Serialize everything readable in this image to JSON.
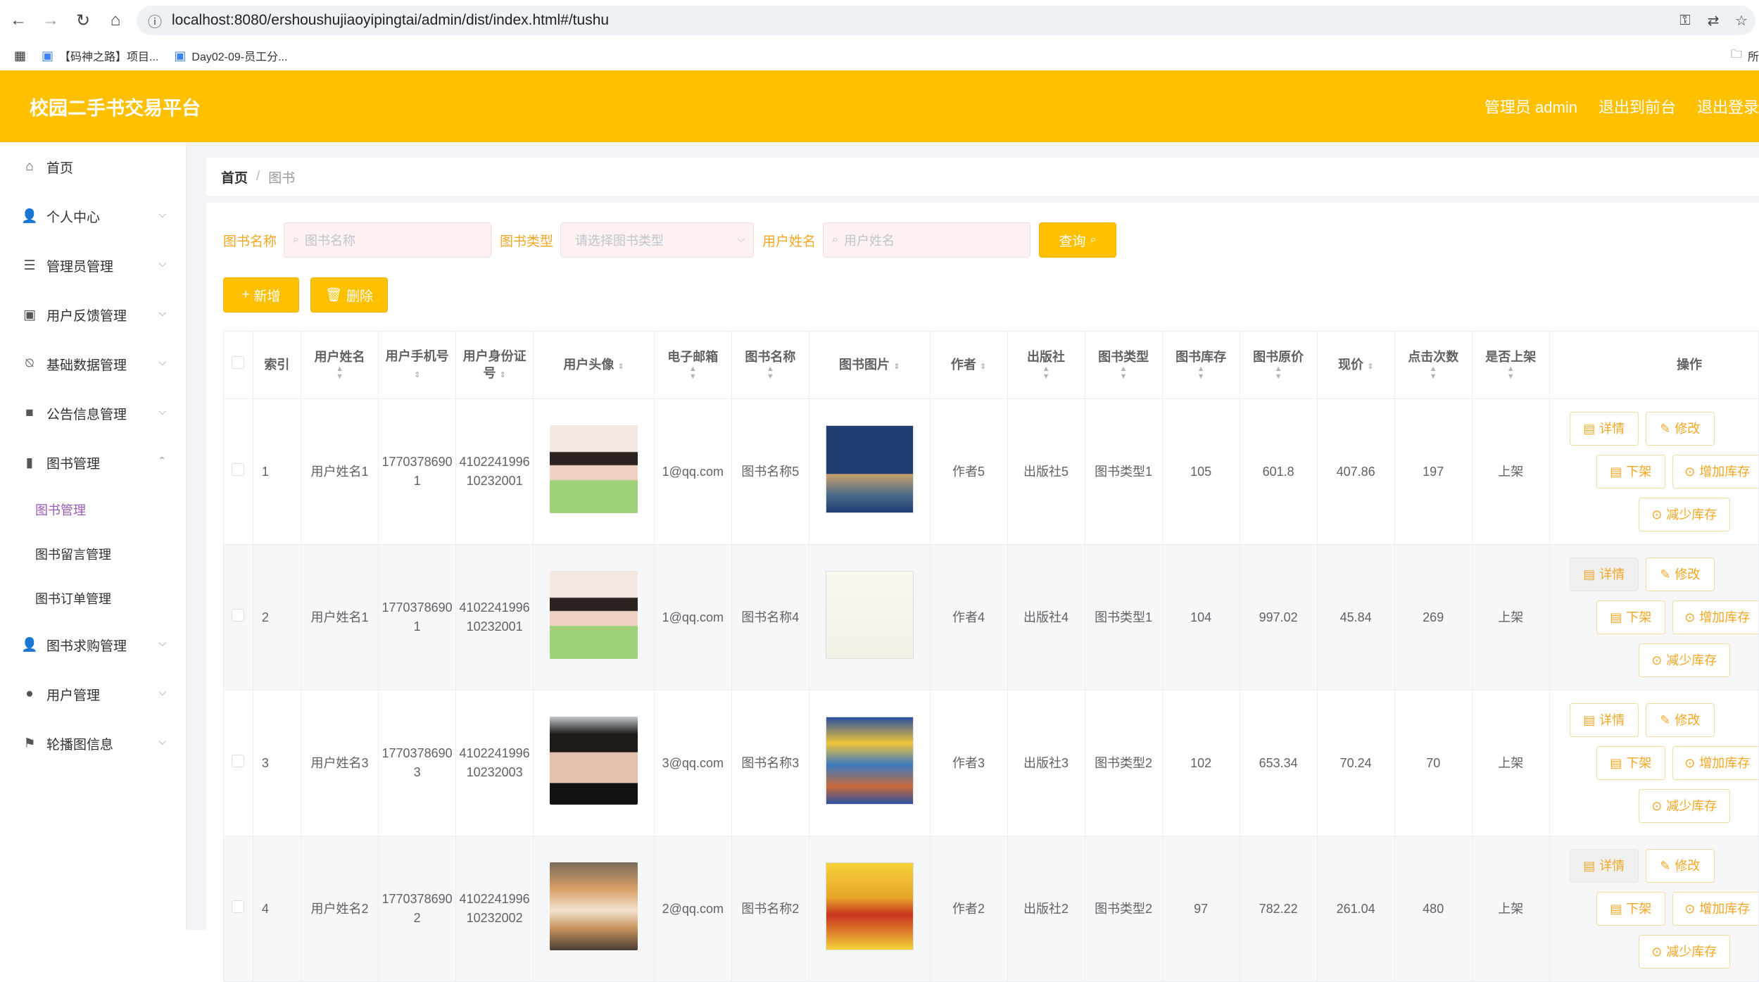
{
  "browser": {
    "url": "localhost:8080/ershoushujiaoyipingtai/admin/dist/index.html#/tushu",
    "bookmarks": [
      "【码神之路】项目...",
      "Day02-09-员工分..."
    ],
    "bookmarks_right": "所"
  },
  "header": {
    "brand": "校园二手书交易平台",
    "admin_label": "管理员 admin",
    "to_front": "退出到前台",
    "logout": "退出登录"
  },
  "sidebar": {
    "items": [
      {
        "label": "首页"
      },
      {
        "label": "个人中心"
      },
      {
        "label": "管理员管理"
      },
      {
        "label": "用户反馈管理"
      },
      {
        "label": "基础数据管理"
      },
      {
        "label": "公告信息管理"
      },
      {
        "label": "图书管理"
      },
      {
        "label": "图书求购管理"
      },
      {
        "label": "用户管理"
      },
      {
        "label": "轮播图信息"
      }
    ],
    "sub_items": [
      "图书管理",
      "图书留言管理",
      "图书订单管理"
    ]
  },
  "breadcrumb": {
    "home": "首页",
    "sep": "/",
    "current": "图书"
  },
  "search": {
    "name_label": "图书名称",
    "name_placeholder": "图书名称",
    "type_label": "图书类型",
    "type_placeholder": "请选择图书类型",
    "user_label": "用户姓名",
    "user_placeholder": "用户姓名",
    "query_button": "查询"
  },
  "actions": {
    "add": "新增",
    "delete": "删除"
  },
  "table": {
    "headers": {
      "index": "索引",
      "username": "用户姓名",
      "phone": "用户手机号",
      "idcard": "用户身份证号",
      "avatar": "用户头像",
      "email": "电子邮箱",
      "bookname": "图书名称",
      "bookimg": "图书图片",
      "author": "作者",
      "publisher": "出版社",
      "booktype": "图书类型",
      "stock": "图书库存",
      "origprice": "图书原价",
      "price": "现价",
      "clicks": "点击次数",
      "onshelf": "是否上架",
      "ops": "操作"
    },
    "rows": [
      {
        "index": "1",
        "username": "用户姓名1",
        "phone": "17703786901",
        "idcard": "410224199610232001",
        "email": "1@qq.com",
        "bookname": "图书名称5",
        "author": "作者5",
        "publisher": "出版社5",
        "booktype": "图书类型1",
        "stock": "105",
        "origprice": "601.8",
        "price": "407.86",
        "clicks": "197",
        "onshelf": "上架"
      },
      {
        "index": "2",
        "username": "用户姓名1",
        "phone": "17703786901",
        "idcard": "410224199610232001",
        "email": "1@qq.com",
        "bookname": "图书名称4",
        "author": "作者4",
        "publisher": "出版社4",
        "booktype": "图书类型1",
        "stock": "104",
        "origprice": "997.02",
        "price": "45.84",
        "clicks": "269",
        "onshelf": "上架"
      },
      {
        "index": "3",
        "username": "用户姓名3",
        "phone": "17703786903",
        "idcard": "410224199610232003",
        "email": "3@qq.com",
        "bookname": "图书名称3",
        "author": "作者3",
        "publisher": "出版社3",
        "booktype": "图书类型2",
        "stock": "102",
        "origprice": "653.34",
        "price": "70.24",
        "clicks": "70",
        "onshelf": "上架"
      },
      {
        "index": "4",
        "username": "用户姓名2",
        "phone": "17703786902",
        "idcard": "410224199610232002",
        "email": "2@qq.com",
        "bookname": "图书名称2",
        "author": "作者2",
        "publisher": "出版社2",
        "booktype": "图书类型2",
        "stock": "97",
        "origprice": "782.22",
        "price": "261.04",
        "clicks": "480",
        "onshelf": "上架"
      }
    ],
    "op_labels": {
      "detail": "详情",
      "edit": "修改",
      "offshelf": "下架",
      "increase": "增加库存",
      "decrease": "减少库存"
    }
  },
  "colors": {
    "accent": "#ffc000",
    "label": "#f5a623",
    "active_menu": "#9b59b6"
  }
}
